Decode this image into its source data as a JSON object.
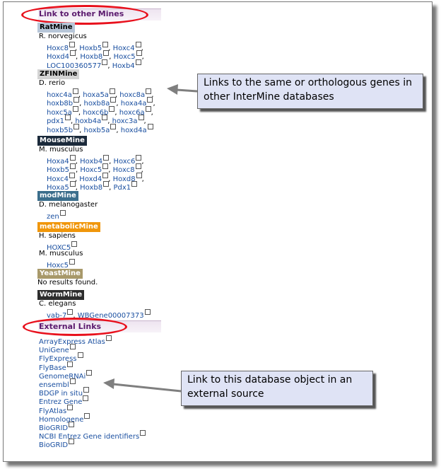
{
  "mines_section": {
    "title": "Link to other Mines"
  },
  "mines": [
    {
      "name": "RatMine",
      "color": "#b7c6d8",
      "text_color": "#000000",
      "groups": [
        {
          "organism": "R. norvegicus",
          "lines": [
            [
              "Hoxc8",
              "Hoxb5",
              "Hoxc4"
            ],
            [
              "Hoxd4",
              "Hoxb8",
              "Hoxc5"
            ],
            [
              "LOC100360577",
              "Hoxb4"
            ]
          ]
        }
      ]
    },
    {
      "name": "ZFINMine",
      "color": "#d4d4d4",
      "text_color": "#000000",
      "groups": [
        {
          "organism": "D. rerio",
          "lines": [
            [
              "hoxc4a",
              "hoxa5a",
              "hoxc8a"
            ],
            [
              "hoxb8b",
              "hoxb8a",
              "hoxa4a"
            ],
            [
              "hoxc5a",
              "hoxc6b",
              "hoxc6a"
            ],
            [
              "pdx1",
              "hoxb4a",
              "hoxc3a"
            ],
            [
              "hoxb5b",
              "hoxb5a",
              "hoxd4a"
            ]
          ]
        }
      ]
    },
    {
      "name": "MouseMine",
      "color": "#1b2a3b",
      "text_color": "#ffffff",
      "groups": [
        {
          "organism": "M. musculus",
          "lines": [
            [
              "Hoxa4",
              "Hoxb4",
              "Hoxc6"
            ],
            [
              "Hoxb5",
              "Hoxc5",
              "Hoxc8"
            ],
            [
              "Hoxc4",
              "Hoxd4",
              "Hoxd8"
            ],
            [
              "Hoxa5",
              "Hoxb8",
              "Pdx1"
            ]
          ]
        }
      ]
    },
    {
      "name": "modMine",
      "color": "#3b6e8c",
      "text_color": "#ffffff",
      "groups": [
        {
          "organism": "D. melanogaster",
          "lines": [
            [
              "zen"
            ]
          ]
        }
      ]
    },
    {
      "name": "metabolicMine",
      "color": "#f0960a",
      "text_color": "#ffffff",
      "groups": [
        {
          "organism": "H. sapiens",
          "lines": [
            [
              "HOXC5"
            ]
          ]
        },
        {
          "organism": "M. musculus",
          "lines": [
            [
              "Hoxc5"
            ]
          ]
        }
      ]
    },
    {
      "name": "YeastMine",
      "color": "#a8996a",
      "text_color": "#ffffff",
      "no_results": "No results found.",
      "groups": []
    },
    {
      "name": "WormMine",
      "color": "#2d2d2d",
      "text_color": "#ffffff",
      "groups": [
        {
          "organism": "C. elegans",
          "lines": [
            [
              "vab-7",
              "WBGene00007373"
            ]
          ]
        }
      ]
    }
  ],
  "external_section": {
    "title": "External Links"
  },
  "external_links": [
    "ArrayExpress Atlas",
    "UniGene",
    "FlyExpress",
    "FlyBase",
    "GenomeRNAi",
    "ensembl",
    "BDGP in situ",
    "Entrez Gene",
    "FlyAtlas",
    "Homologene",
    "BioGRID",
    "NCBI Entrez Gene identifiers",
    "BioGRID"
  ],
  "callouts": {
    "top": "Links to the same or orthologous genes in other InterMine databases",
    "bottom": "Link to this database object in an external source"
  },
  "colors": {
    "link": "#1a4fa0",
    "heading": "#5b1a6e",
    "highlight": "#e8101c",
    "callout_bg": "#dfe3f5"
  }
}
